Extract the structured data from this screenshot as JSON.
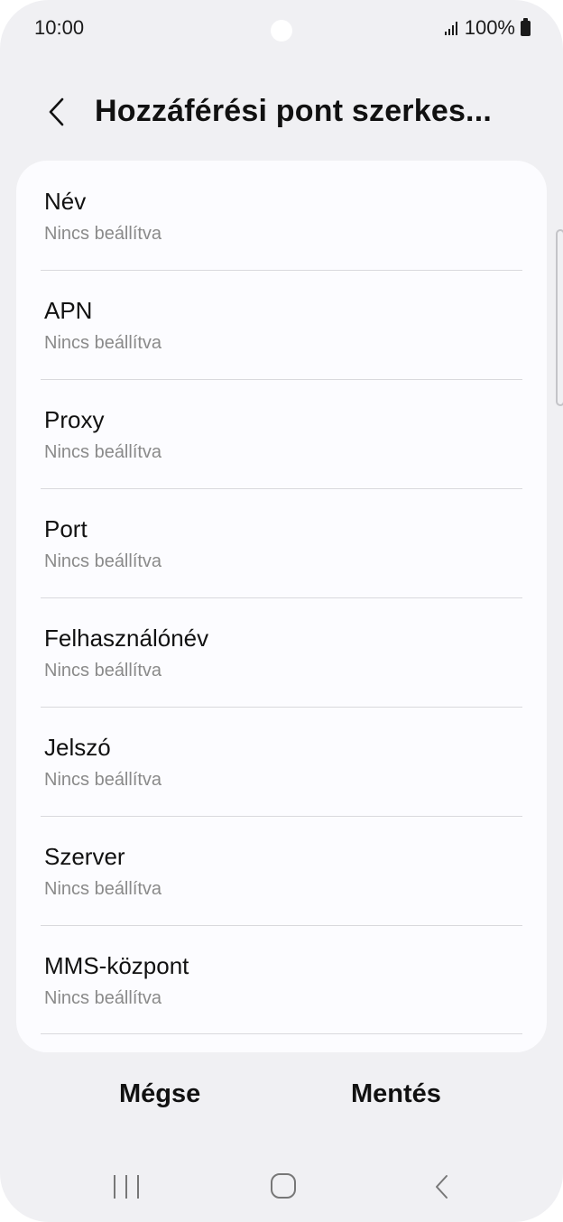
{
  "status_bar": {
    "time": "10:00",
    "battery_text": "100%"
  },
  "header": {
    "title": "Hozzáférési pont szerkes..."
  },
  "fields": [
    {
      "label": "Név",
      "value": "Nincs beállítva"
    },
    {
      "label": "APN",
      "value": "Nincs beállítva"
    },
    {
      "label": "Proxy",
      "value": "Nincs beállítva"
    },
    {
      "label": "Port",
      "value": "Nincs beállítva"
    },
    {
      "label": "Felhasználónév",
      "value": "Nincs beállítva"
    },
    {
      "label": "Jelszó",
      "value": "Nincs beállítva"
    },
    {
      "label": "Szerver",
      "value": "Nincs beállítva"
    },
    {
      "label": "MMS-központ",
      "value": "Nincs beállítva"
    }
  ],
  "actions": {
    "cancel_label": "Mégse",
    "save_label": "Mentés"
  },
  "icons": {
    "back": "chevron-left-icon",
    "signal": "signal-icon",
    "battery": "battery-icon",
    "nav_recent": "recent-apps-icon",
    "nav_home": "home-icon",
    "nav_back": "back-icon"
  },
  "colors": {
    "background": "#f0f0f3",
    "card": "#fcfcff",
    "text_primary": "#111111",
    "text_secondary": "#8a8a8a"
  }
}
